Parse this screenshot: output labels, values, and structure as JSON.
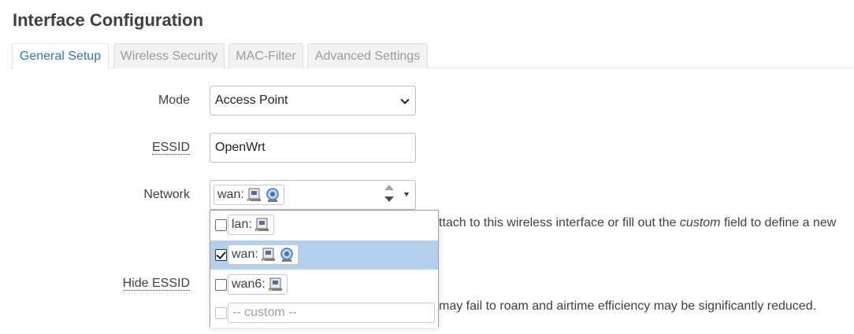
{
  "page": {
    "title": "Interface Configuration"
  },
  "tabs": [
    {
      "label": "General Setup",
      "active": true
    },
    {
      "label": "Wireless Security",
      "active": false
    },
    {
      "label": "MAC-Filter",
      "active": false
    },
    {
      "label": "Advanced Settings",
      "active": false
    }
  ],
  "mode": {
    "label": "Mode",
    "value": "Access Point"
  },
  "essid": {
    "label": "ESSID",
    "value": "OpenWrt"
  },
  "network": {
    "label": "Network",
    "selected_chip": "wan:",
    "help_before": "ttach to this wireless interface or fill out the ",
    "help_em": "custom",
    "help_after": " field to define a new",
    "options": [
      {
        "label": "lan:",
        "checked": false,
        "icons": [
          "ethernet-port-icon"
        ]
      },
      {
        "label": "wan:",
        "checked": true,
        "icons": [
          "ethernet-port-icon",
          "wireless-icon"
        ]
      },
      {
        "label": "wan6:",
        "checked": false,
        "icons": [
          "ethernet-port-icon"
        ]
      }
    ],
    "custom_placeholder": "-- custom --"
  },
  "hide_essid": {
    "label": "Hide ESSID",
    "help": "may fail to roam and airtime efficiency may be significantly reduced."
  },
  "colors": {
    "accent": "#2a7ac0",
    "selected_row": "#b4d0ec",
    "text": "#404040"
  }
}
